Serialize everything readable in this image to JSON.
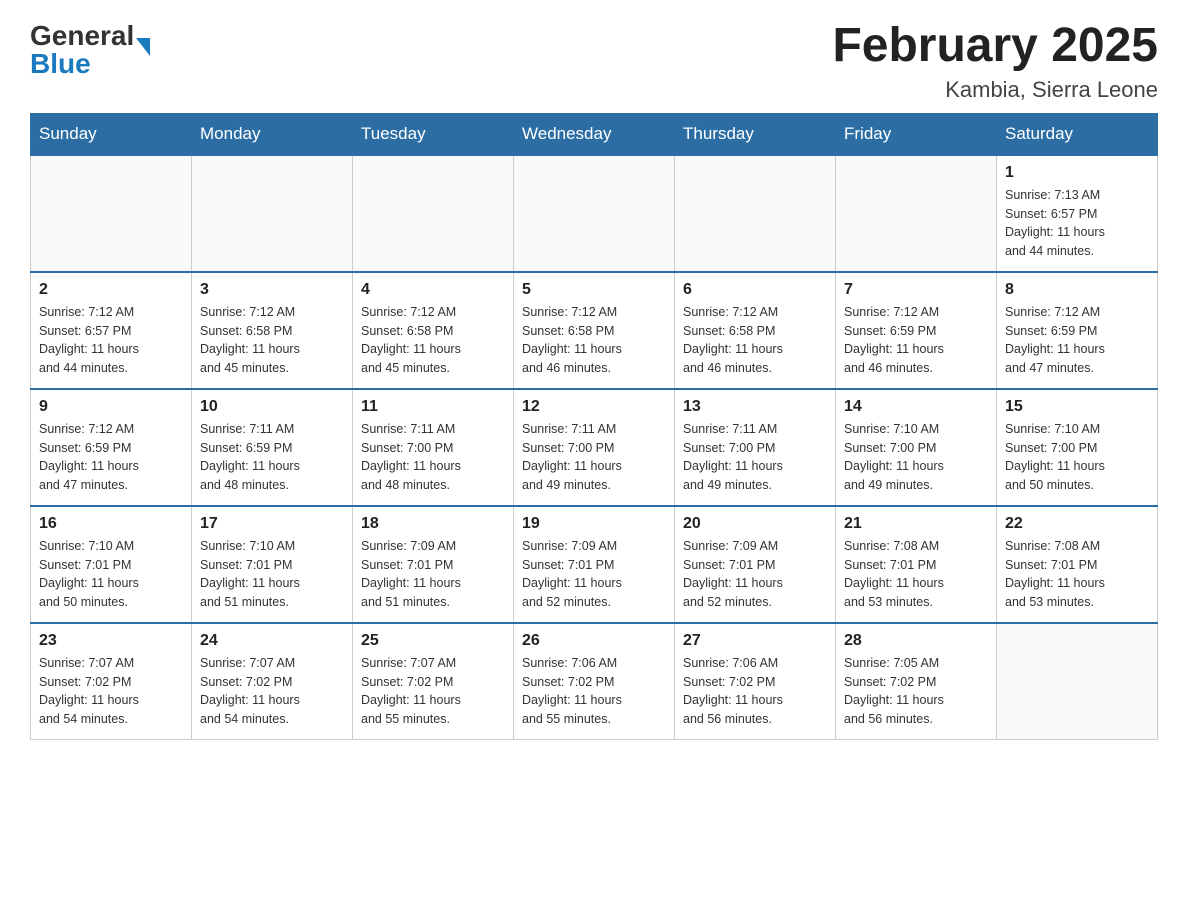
{
  "header": {
    "logo_general": "General",
    "logo_blue": "Blue",
    "month_year": "February 2025",
    "location": "Kambia, Sierra Leone"
  },
  "days_of_week": [
    "Sunday",
    "Monday",
    "Tuesday",
    "Wednesday",
    "Thursday",
    "Friday",
    "Saturday"
  ],
  "weeks": [
    [
      {
        "day": "",
        "info": ""
      },
      {
        "day": "",
        "info": ""
      },
      {
        "day": "",
        "info": ""
      },
      {
        "day": "",
        "info": ""
      },
      {
        "day": "",
        "info": ""
      },
      {
        "day": "",
        "info": ""
      },
      {
        "day": "1",
        "info": "Sunrise: 7:13 AM\nSunset: 6:57 PM\nDaylight: 11 hours\nand 44 minutes."
      }
    ],
    [
      {
        "day": "2",
        "info": "Sunrise: 7:12 AM\nSunset: 6:57 PM\nDaylight: 11 hours\nand 44 minutes."
      },
      {
        "day": "3",
        "info": "Sunrise: 7:12 AM\nSunset: 6:58 PM\nDaylight: 11 hours\nand 45 minutes."
      },
      {
        "day": "4",
        "info": "Sunrise: 7:12 AM\nSunset: 6:58 PM\nDaylight: 11 hours\nand 45 minutes."
      },
      {
        "day": "5",
        "info": "Sunrise: 7:12 AM\nSunset: 6:58 PM\nDaylight: 11 hours\nand 46 minutes."
      },
      {
        "day": "6",
        "info": "Sunrise: 7:12 AM\nSunset: 6:58 PM\nDaylight: 11 hours\nand 46 minutes."
      },
      {
        "day": "7",
        "info": "Sunrise: 7:12 AM\nSunset: 6:59 PM\nDaylight: 11 hours\nand 46 minutes."
      },
      {
        "day": "8",
        "info": "Sunrise: 7:12 AM\nSunset: 6:59 PM\nDaylight: 11 hours\nand 47 minutes."
      }
    ],
    [
      {
        "day": "9",
        "info": "Sunrise: 7:12 AM\nSunset: 6:59 PM\nDaylight: 11 hours\nand 47 minutes."
      },
      {
        "day": "10",
        "info": "Sunrise: 7:11 AM\nSunset: 6:59 PM\nDaylight: 11 hours\nand 48 minutes."
      },
      {
        "day": "11",
        "info": "Sunrise: 7:11 AM\nSunset: 7:00 PM\nDaylight: 11 hours\nand 48 minutes."
      },
      {
        "day": "12",
        "info": "Sunrise: 7:11 AM\nSunset: 7:00 PM\nDaylight: 11 hours\nand 49 minutes."
      },
      {
        "day": "13",
        "info": "Sunrise: 7:11 AM\nSunset: 7:00 PM\nDaylight: 11 hours\nand 49 minutes."
      },
      {
        "day": "14",
        "info": "Sunrise: 7:10 AM\nSunset: 7:00 PM\nDaylight: 11 hours\nand 49 minutes."
      },
      {
        "day": "15",
        "info": "Sunrise: 7:10 AM\nSunset: 7:00 PM\nDaylight: 11 hours\nand 50 minutes."
      }
    ],
    [
      {
        "day": "16",
        "info": "Sunrise: 7:10 AM\nSunset: 7:01 PM\nDaylight: 11 hours\nand 50 minutes."
      },
      {
        "day": "17",
        "info": "Sunrise: 7:10 AM\nSunset: 7:01 PM\nDaylight: 11 hours\nand 51 minutes."
      },
      {
        "day": "18",
        "info": "Sunrise: 7:09 AM\nSunset: 7:01 PM\nDaylight: 11 hours\nand 51 minutes."
      },
      {
        "day": "19",
        "info": "Sunrise: 7:09 AM\nSunset: 7:01 PM\nDaylight: 11 hours\nand 52 minutes."
      },
      {
        "day": "20",
        "info": "Sunrise: 7:09 AM\nSunset: 7:01 PM\nDaylight: 11 hours\nand 52 minutes."
      },
      {
        "day": "21",
        "info": "Sunrise: 7:08 AM\nSunset: 7:01 PM\nDaylight: 11 hours\nand 53 minutes."
      },
      {
        "day": "22",
        "info": "Sunrise: 7:08 AM\nSunset: 7:01 PM\nDaylight: 11 hours\nand 53 minutes."
      }
    ],
    [
      {
        "day": "23",
        "info": "Sunrise: 7:07 AM\nSunset: 7:02 PM\nDaylight: 11 hours\nand 54 minutes."
      },
      {
        "day": "24",
        "info": "Sunrise: 7:07 AM\nSunset: 7:02 PM\nDaylight: 11 hours\nand 54 minutes."
      },
      {
        "day": "25",
        "info": "Sunrise: 7:07 AM\nSunset: 7:02 PM\nDaylight: 11 hours\nand 55 minutes."
      },
      {
        "day": "26",
        "info": "Sunrise: 7:06 AM\nSunset: 7:02 PM\nDaylight: 11 hours\nand 55 minutes."
      },
      {
        "day": "27",
        "info": "Sunrise: 7:06 AM\nSunset: 7:02 PM\nDaylight: 11 hours\nand 56 minutes."
      },
      {
        "day": "28",
        "info": "Sunrise: 7:05 AM\nSunset: 7:02 PM\nDaylight: 11 hours\nand 56 minutes."
      },
      {
        "day": "",
        "info": ""
      }
    ]
  ]
}
